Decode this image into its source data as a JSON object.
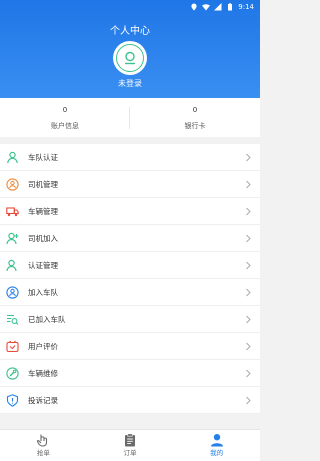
{
  "status": {
    "time": "9:14"
  },
  "header": {
    "title": "个人中心",
    "login_label": "未登录"
  },
  "stats": [
    {
      "value": "0",
      "label": "账户信息"
    },
    {
      "value": "0",
      "label": "银行卡"
    }
  ],
  "menu": [
    {
      "label": "车队认证",
      "icon": "person-icon",
      "color": "#3ec28f"
    },
    {
      "label": "司机管理",
      "icon": "driver-manage-icon",
      "color": "#f08a3a"
    },
    {
      "label": "车辆管理",
      "icon": "truck-icon",
      "color": "#e84a3a"
    },
    {
      "label": "司机加入",
      "icon": "person-add-icon",
      "color": "#3ec28f"
    },
    {
      "label": "认证管理",
      "icon": "person-check-icon",
      "color": "#3ec28f"
    },
    {
      "label": "加入车队",
      "icon": "team-join-icon",
      "color": "#2680eb"
    },
    {
      "label": "已加入车队",
      "icon": "list-search-icon",
      "color": "#3ec28f"
    },
    {
      "label": "用户评价",
      "icon": "rating-icon",
      "color": "#e84a3a"
    },
    {
      "label": "车辆维修",
      "icon": "wrench-icon",
      "color": "#3ec28f"
    },
    {
      "label": "投诉记录",
      "icon": "shield-icon",
      "color": "#2680eb"
    }
  ],
  "tabs": [
    {
      "label": "抢单",
      "icon": "grab-order-icon",
      "active": false
    },
    {
      "label": "订单",
      "icon": "order-icon",
      "active": false
    },
    {
      "label": "我的",
      "icon": "profile-icon",
      "active": true
    }
  ],
  "colors": {
    "primary": "#2680eb",
    "header_top": "#1f76e6",
    "green": "#3ec28f",
    "red": "#e84a3a",
    "orange": "#f08a3a"
  }
}
